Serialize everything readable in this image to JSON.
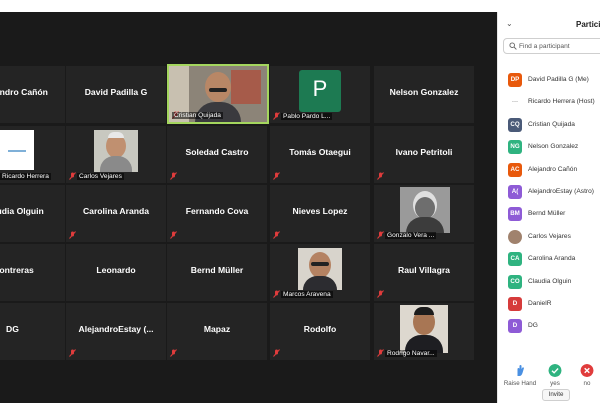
{
  "gallery": {
    "tiles": [
      {
        "name": "Alejandro Cañón",
        "caption": ""
      },
      {
        "name": "David Padilla G",
        "caption": ""
      },
      {
        "name": "",
        "caption": "Cristian Quijada"
      },
      {
        "name": "P",
        "caption": "Pablo Pardo L..."
      },
      {
        "name": "Nelson Gonzalez",
        "caption": ""
      },
      {
        "name": "",
        "caption": "Ricardo Herrera"
      },
      {
        "name": "",
        "caption": "Carlos Vejares"
      },
      {
        "name": "Soledad Castro",
        "caption": ""
      },
      {
        "name": "Tomás Otaegui",
        "caption": ""
      },
      {
        "name": "Ivano Petritoli",
        "caption": ""
      },
      {
        "name": "Claudia Olguin",
        "caption": ""
      },
      {
        "name": "Carolina Aranda",
        "caption": ""
      },
      {
        "name": "Fernando Cova",
        "caption": ""
      },
      {
        "name": "Nieves Lopez",
        "caption": ""
      },
      {
        "name": "",
        "caption": "Gonzalo Vera ..."
      },
      {
        "name": "Contreras",
        "caption": ""
      },
      {
        "name": "Leonardo",
        "caption": ""
      },
      {
        "name": "Bernd Müller",
        "caption": ""
      },
      {
        "name": "",
        "caption": "Marcos Aravena"
      },
      {
        "name": "Raul Villagra",
        "caption": ""
      },
      {
        "name": "DG",
        "caption": ""
      },
      {
        "name": "AlejandroEstay (...",
        "caption": ""
      },
      {
        "name": "Mapaz",
        "caption": ""
      },
      {
        "name": "Rodolfo",
        "caption": ""
      },
      {
        "name": "",
        "caption": "Rodrigo Navar..."
      }
    ]
  },
  "panel": {
    "title": "Participants",
    "search_placeholder": "Find a participant",
    "participants": [
      {
        "initials": "DP",
        "color": "#e8590c",
        "name": "David Padilla G (Me)"
      },
      {
        "initials": "---",
        "color": "",
        "name": "Ricardo Herrera (Host)"
      },
      {
        "initials": "CQ",
        "color": "#4a5a78",
        "name": "Cristian Quijada"
      },
      {
        "initials": "NG",
        "color": "#2fb380",
        "name": "Nelson Gonzalez"
      },
      {
        "initials": "AC",
        "color": "#e8590c",
        "name": "Alejandro Cañón"
      },
      {
        "initials": "A(",
        "color": "#8e5bd6",
        "name": "AlejandroEstay (Astro)"
      },
      {
        "initials": "BM",
        "color": "#8e5bd6",
        "name": "Bernd Müller"
      },
      {
        "initials": "",
        "color": "#a0826d",
        "name": "Carlos Vejares"
      },
      {
        "initials": "CA",
        "color": "#2fb380",
        "name": "Carolina Aranda"
      },
      {
        "initials": "CO",
        "color": "#2fb380",
        "name": "Claudia Olguin"
      },
      {
        "initials": "D",
        "color": "#d63b3b",
        "name": "DanielR"
      },
      {
        "initials": "D",
        "color": "#8e5bd6",
        "name": "DG"
      }
    ],
    "reactions": [
      {
        "label": "Raise Hand",
        "icon": "raise-hand-icon",
        "color": "#4a90e2"
      },
      {
        "label": "yes",
        "icon": "check-icon",
        "color": "#2fb380"
      },
      {
        "label": "no",
        "icon": "x-icon",
        "color": "#e03c3c"
      }
    ],
    "invite_label": "Invite"
  },
  "colors": {
    "gallery_bg": "#1a1a1a",
    "tile_bg": "#242424",
    "active_speaker_border": "#a4d65e",
    "mute_icon": "#e03c3c",
    "pablo_avatar": "#1d7a52"
  }
}
